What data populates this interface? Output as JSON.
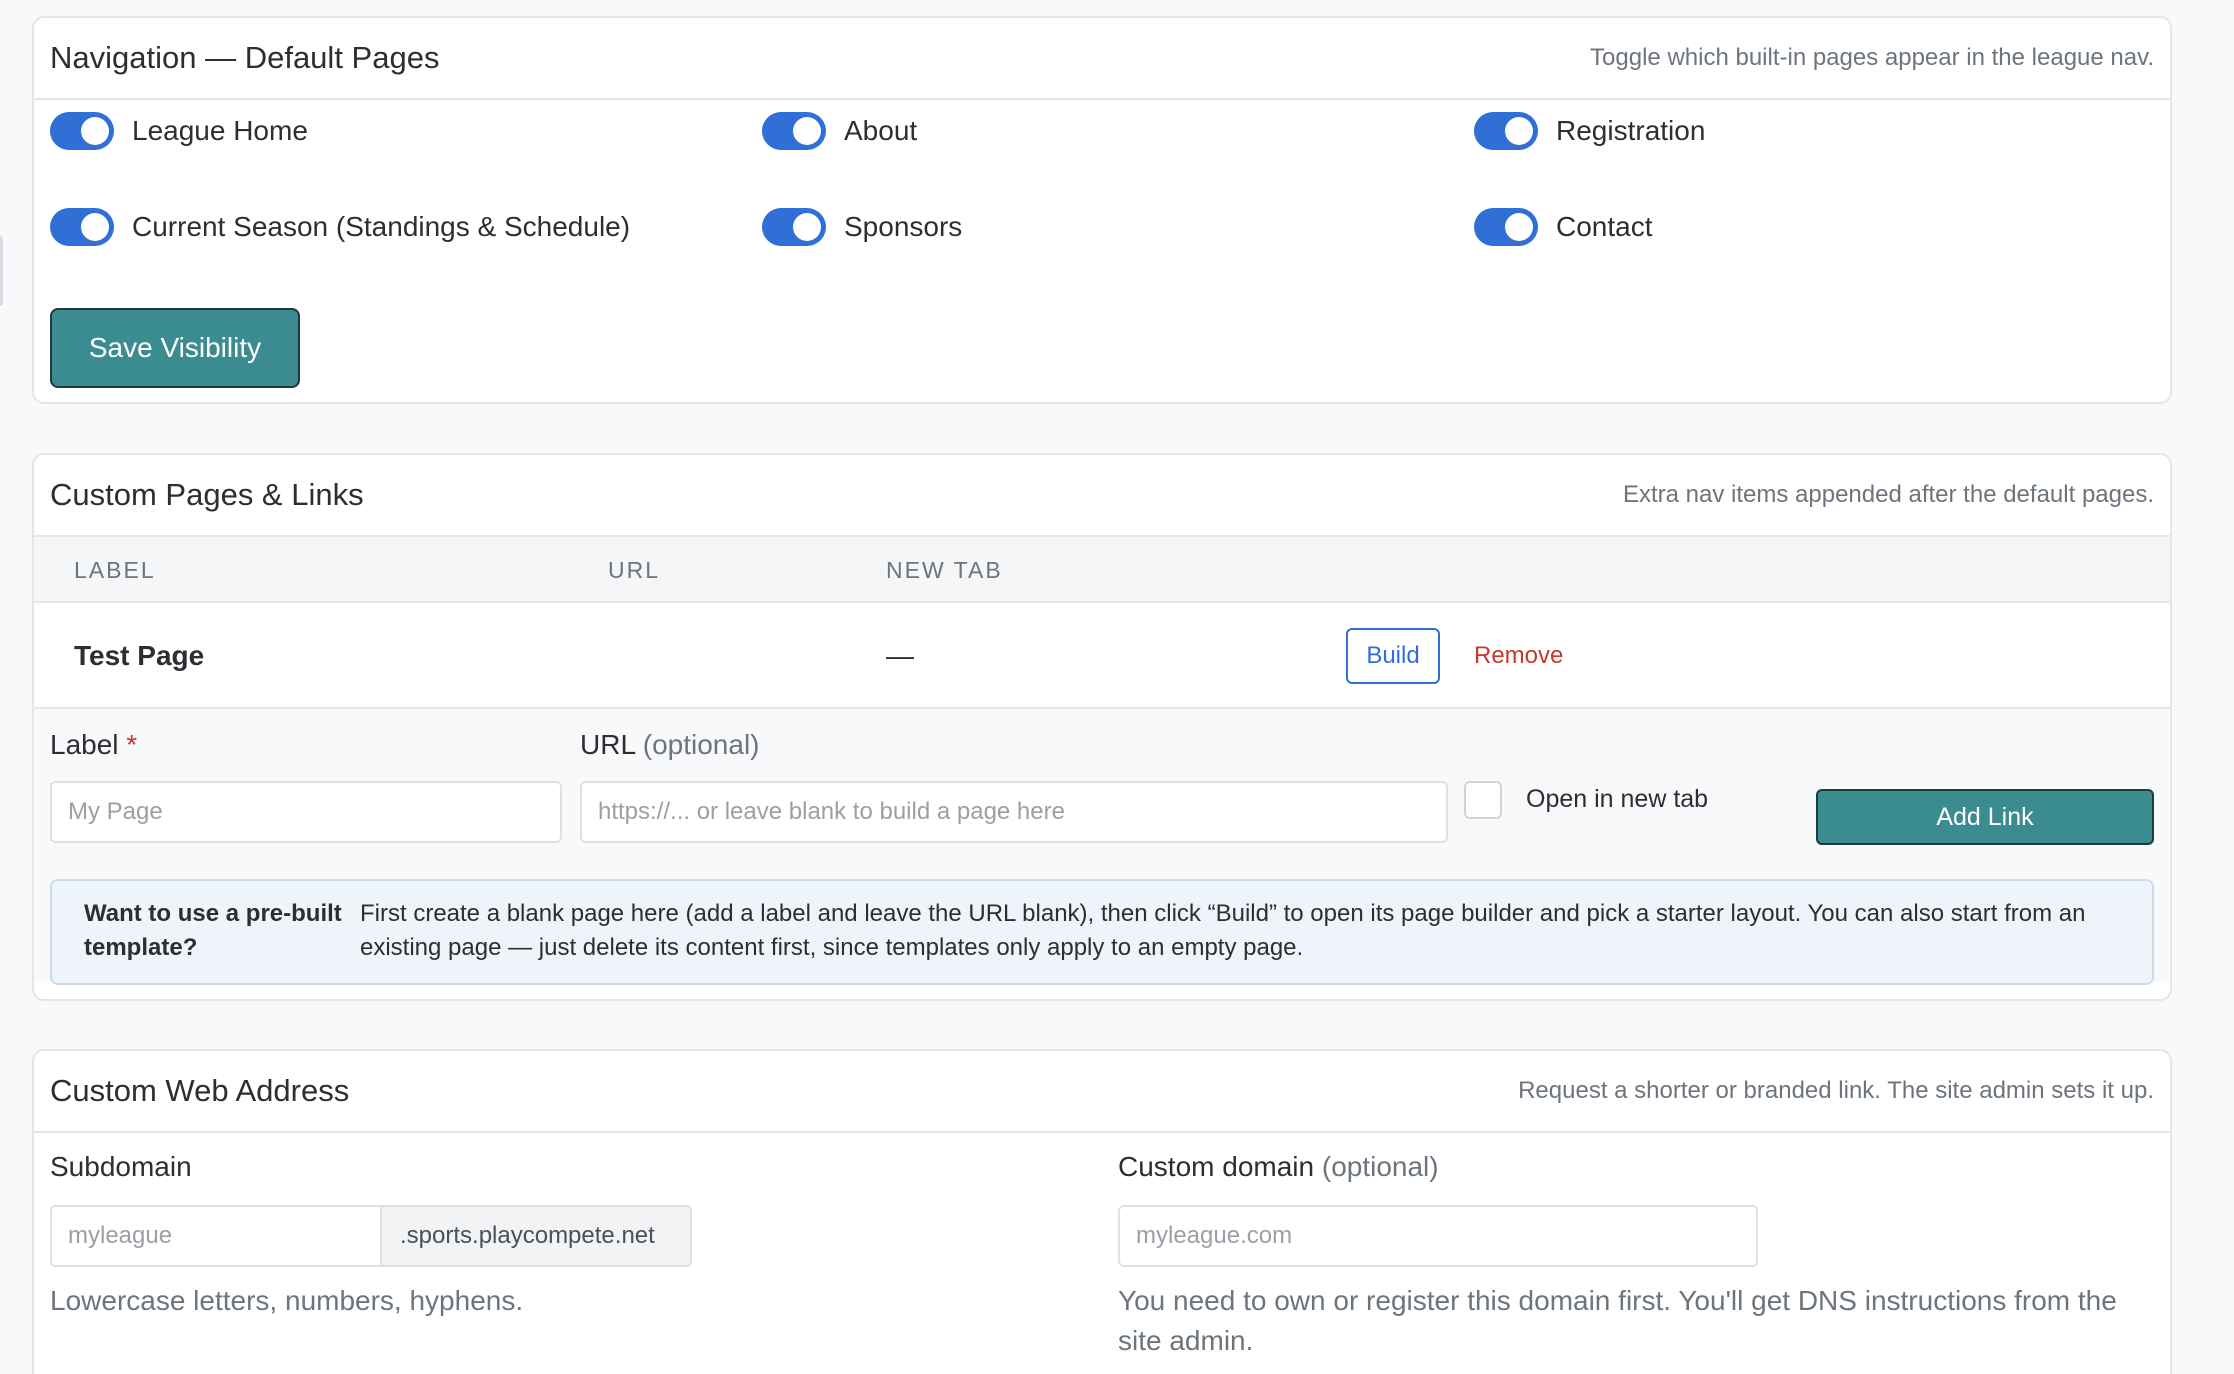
{
  "nav": {
    "title": "Navigation — Default Pages",
    "subtitle": "Toggle which built-in pages appear in the league nav.",
    "toggles": [
      {
        "label": "League Home",
        "on": true
      },
      {
        "label": "About",
        "on": true
      },
      {
        "label": "Registration",
        "on": true
      },
      {
        "label": "Current Season (Standings & Schedule)",
        "on": true
      },
      {
        "label": "Sponsors",
        "on": true
      },
      {
        "label": "Contact",
        "on": true
      }
    ],
    "save_label": "Save Visibility"
  },
  "custom": {
    "title": "Custom Pages & Links",
    "subtitle": "Extra nav items appended after the default pages.",
    "columns": {
      "label": "LABEL",
      "url": "URL",
      "new_tab": "NEW TAB"
    },
    "rows": [
      {
        "label": "Test Page",
        "url": "",
        "new_tab": "—",
        "build_label": "Build",
        "remove_label": "Remove"
      }
    ],
    "form": {
      "label_field": "Label",
      "required_mark": "*",
      "label_placeholder": "My Page",
      "url_field": "URL",
      "url_optional": "(optional)",
      "url_placeholder": "https://... or leave blank to build a page here",
      "new_tab_label": "Open in new tab",
      "add_label": "Add Link"
    },
    "info": {
      "title": "Want to use a pre-built template?",
      "text": "First create a blank page here (add a label and leave the URL blank), then click “Build” to open its page builder and pick a starter layout. You can also start from an existing page — just delete its content first, since templates only apply to an empty page."
    }
  },
  "address": {
    "title": "Custom Web Address",
    "subtitle": "Request a shorter or branded link. The site admin sets it up.",
    "subdomain_label": "Subdomain",
    "subdomain_placeholder": "myleague",
    "subdomain_suffix": ".sports.playcompete.net",
    "subdomain_help": "Lowercase letters, numbers, hyphens.",
    "domain_label": "Custom domain",
    "domain_optional": "(optional)",
    "domain_placeholder": "myleague.com",
    "domain_help": "You need to own or register this domain first. You'll get DNS instructions from the site admin."
  },
  "colors": {
    "primary": "#2f6fd6",
    "teal": "#3a8c91",
    "danger": "#c9372c"
  }
}
